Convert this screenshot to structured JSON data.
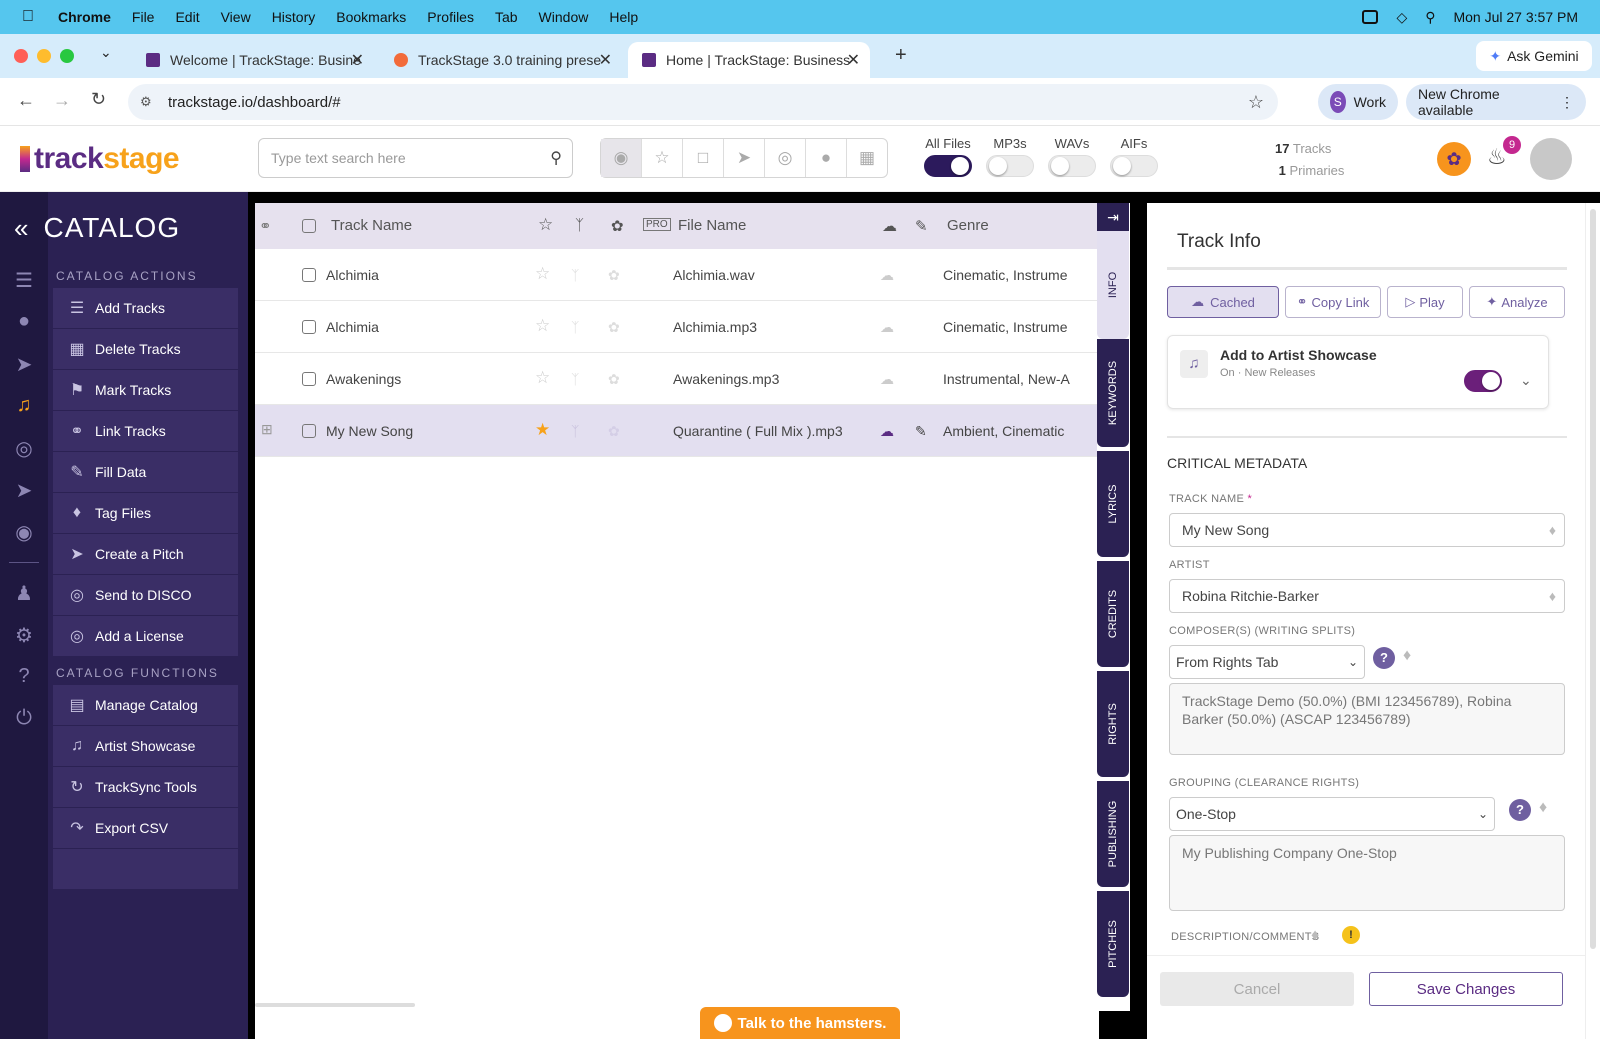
{
  "menubar": {
    "app": "Chrome",
    "items": [
      "File",
      "Edit",
      "View",
      "History",
      "Bookmarks",
      "Profiles",
      "Tab",
      "Window",
      "Help"
    ],
    "datetime": "Mon Jul 27  3:57 PM"
  },
  "tabs": [
    {
      "title": "Welcome | TrackStage: Busine"
    },
    {
      "title": "TrackStage 3.0 training prese"
    },
    {
      "title": "Home | TrackStage: Business"
    }
  ],
  "omnibox": {
    "url": "trackstage.io/dashboard/#",
    "profile": "Work",
    "profile_initial": "S",
    "update": "New Chrome available",
    "gemini": "Ask Gemini"
  },
  "header": {
    "logo_a": "track",
    "logo_b": "stage",
    "search_placeholder": "Type text search here",
    "filters": [
      {
        "label": "All Files",
        "on": true
      },
      {
        "label": "MP3s",
        "on": false
      },
      {
        "label": "WAVs",
        "on": false
      },
      {
        "label": "AIFs",
        "on": false
      }
    ],
    "tracks_count": "17",
    "tracks_label": "Tracks",
    "primaries_count": "1",
    "primaries_label": "Primaries",
    "notifications": "9"
  },
  "sidebar": {
    "title": "CATALOG",
    "actions_heading": "CATALOG ACTIONS",
    "actions": [
      "Add Tracks",
      "Delete Tracks",
      "Mark Tracks",
      "Link Tracks",
      "Fill Data",
      "Tag Files",
      "Create a Pitch",
      "Send to DISCO",
      "Add a License"
    ],
    "functions_heading": "CATALOG FUNCTIONS",
    "functions": [
      "Manage Catalog",
      "Artist Showcase",
      "TrackSync Tools",
      "Export CSV"
    ]
  },
  "table": {
    "headers": {
      "track": "Track Name",
      "file": "File Name",
      "genre": "Genre"
    },
    "rows": [
      {
        "track": "Alchimia",
        "file": "Alchimia.wav",
        "genre": "Cinematic, Instrume",
        "selected": false
      },
      {
        "track": "Alchimia",
        "file": "Alchimia.mp3",
        "genre": "Cinematic, Instrume",
        "selected": false
      },
      {
        "track": "Awakenings",
        "file": "Awakenings.mp3",
        "genre": "Instrumental, New-A",
        "selected": false
      },
      {
        "track": "My New Song",
        "file": "Quarantine ( Full Mix ).mp3",
        "genre": "Ambient, Cinematic",
        "selected": true
      }
    ]
  },
  "vtabs": [
    "INFO",
    "KEYWORDS",
    "LYRICS",
    "CREDITS",
    "RIGHTS",
    "PUBLISHING",
    "PITCHES"
  ],
  "panel": {
    "title": "Track Info",
    "buttons": [
      "Cached",
      "Copy Link",
      "Play",
      "Analyze"
    ],
    "showcase_title": "Add to Artist Showcase",
    "showcase_sub": "On · New Releases",
    "section": "CRITICAL METADATA",
    "track_name_label": "TRACK NAME",
    "required_mark": "*",
    "track_name": "My New Song",
    "artist_label": "ARTIST",
    "artist": "Robina Ritchie-Barker",
    "composers_label": "COMPOSER(S) (WRITING SPLITS)",
    "composers_select": "From Rights Tab",
    "composers_text": "TrackStage Demo (50.0%) (BMI 123456789), Robina Barker (50.0%) (ASCAP 123456789)",
    "grouping_label": "GROUPING (CLEARANCE RIGHTS)",
    "grouping_select": "One-Stop",
    "grouping_text": "My Publishing Company One-Stop",
    "description_label": "DESCRIPTION/COMMENTS",
    "cancel": "Cancel",
    "save": "Save Changes"
  },
  "chat": "Talk to the hamsters."
}
